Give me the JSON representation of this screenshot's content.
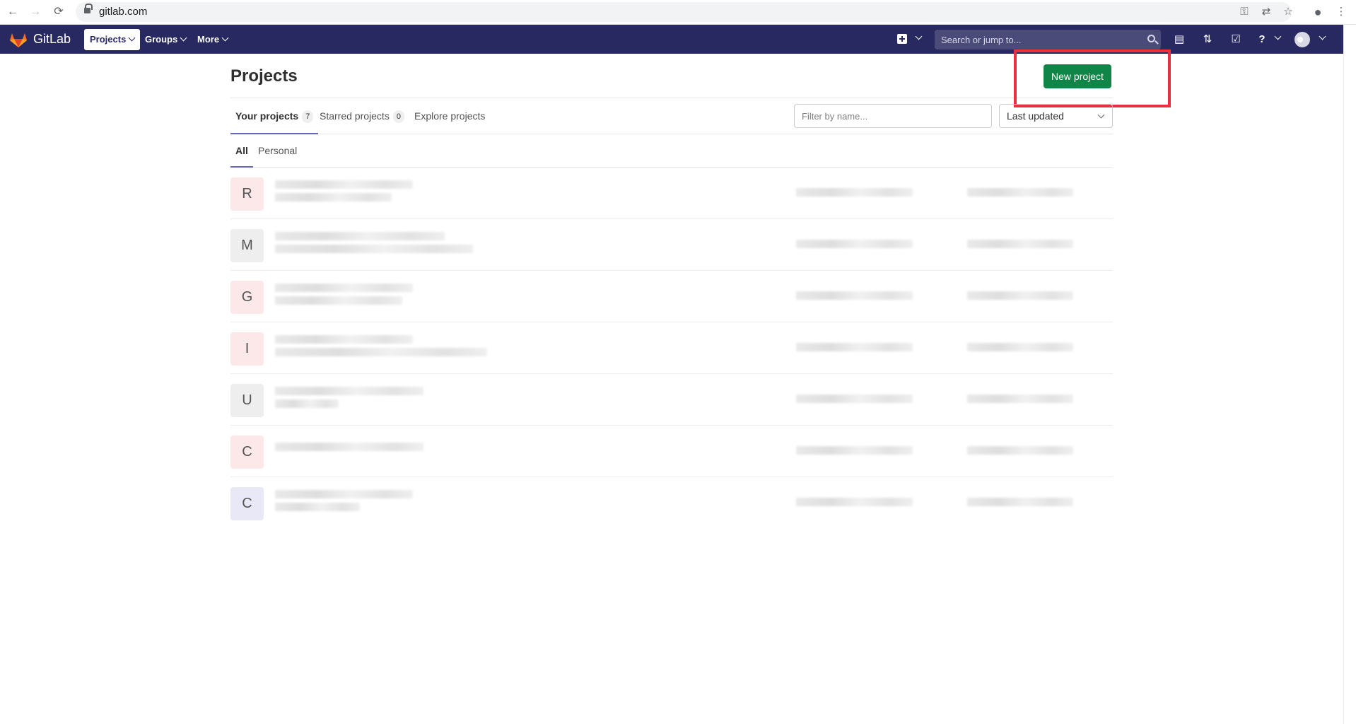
{
  "browser": {
    "url": "gitlab.com",
    "icons": {
      "back": "arrow-left-icon",
      "forward": "arrow-right-icon",
      "reload": "reload-icon",
      "lock": "lock-icon",
      "key": "key-icon",
      "translate": "translate-icon",
      "star": "star-icon",
      "profile": "profile-icon",
      "menu": "kebab-menu-icon"
    }
  },
  "navbar": {
    "brand": "GitLab",
    "links": [
      {
        "label": "Projects",
        "active": true
      },
      {
        "label": "Groups",
        "active": false
      },
      {
        "label": "More",
        "active": false
      }
    ],
    "search_placeholder": "Search or jump to...",
    "colors": {
      "background": "#292961",
      "search_bg": "#4b4b7a"
    }
  },
  "page": {
    "title": "Projects",
    "new_project_label": "New project",
    "tabs": [
      {
        "label": "Your projects",
        "count": "7",
        "active": true
      },
      {
        "label": "Starred projects",
        "count": "0",
        "active": false
      },
      {
        "label": "Explore projects",
        "count": null,
        "active": false
      }
    ],
    "filter_placeholder": "Filter by name...",
    "sort_value": "Last updated",
    "subtabs": [
      {
        "label": "All",
        "active": true
      },
      {
        "label": "Personal",
        "active": false
      }
    ],
    "projects": [
      {
        "initial": "R",
        "avatar_color": "#fce8e8"
      },
      {
        "initial": "M",
        "avatar_color": "#eeeeee"
      },
      {
        "initial": "G",
        "avatar_color": "#fce8e8"
      },
      {
        "initial": "I",
        "avatar_color": "#fce8e8"
      },
      {
        "initial": "U",
        "avatar_color": "#eeeeee"
      },
      {
        "initial": "C",
        "avatar_color": "#fce8e8"
      },
      {
        "initial": "C",
        "avatar_color": "#e8e8f6"
      }
    ],
    "colors": {
      "primary_button": "#108548",
      "highlight": "#e8303f",
      "active_tab": "#6666c4"
    }
  }
}
